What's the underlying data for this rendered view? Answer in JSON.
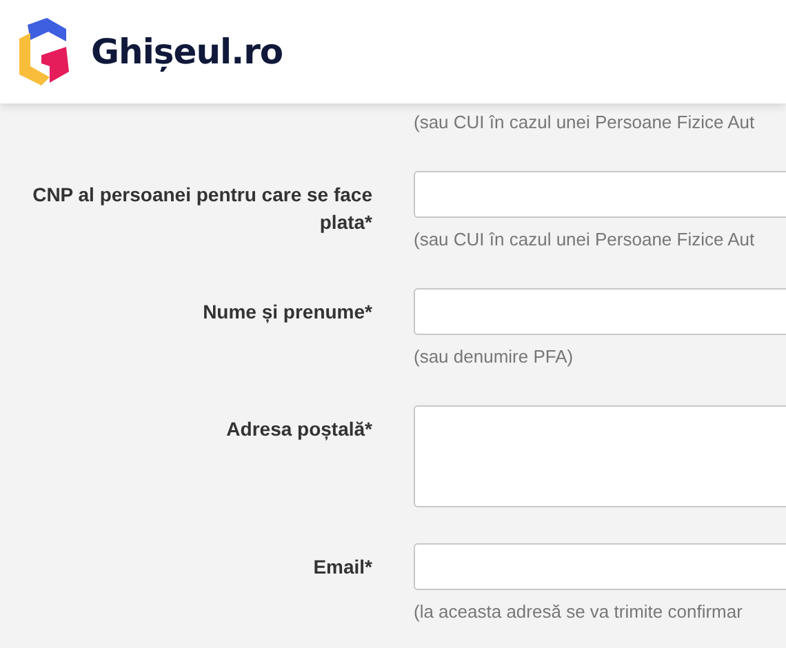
{
  "header": {
    "logo_text": "Ghișeul.ro"
  },
  "top_hint": "(sau CUI în cazul unei Persoane Fizice Aut",
  "fields": [
    {
      "label": "CNP al persoanei pentru care se face plata*",
      "kind": "input",
      "hint": "(sau CUI în cazul unei Persoane Fizice Aut"
    },
    {
      "label": "Nume și prenume*",
      "kind": "input",
      "hint": "(sau denumire PFA)"
    },
    {
      "label": "Adresa poștală*",
      "kind": "textarea"
    },
    {
      "label": "Email*",
      "kind": "input",
      "hint": "(la aceasta adresă se va trimite confirmar"
    }
  ]
}
